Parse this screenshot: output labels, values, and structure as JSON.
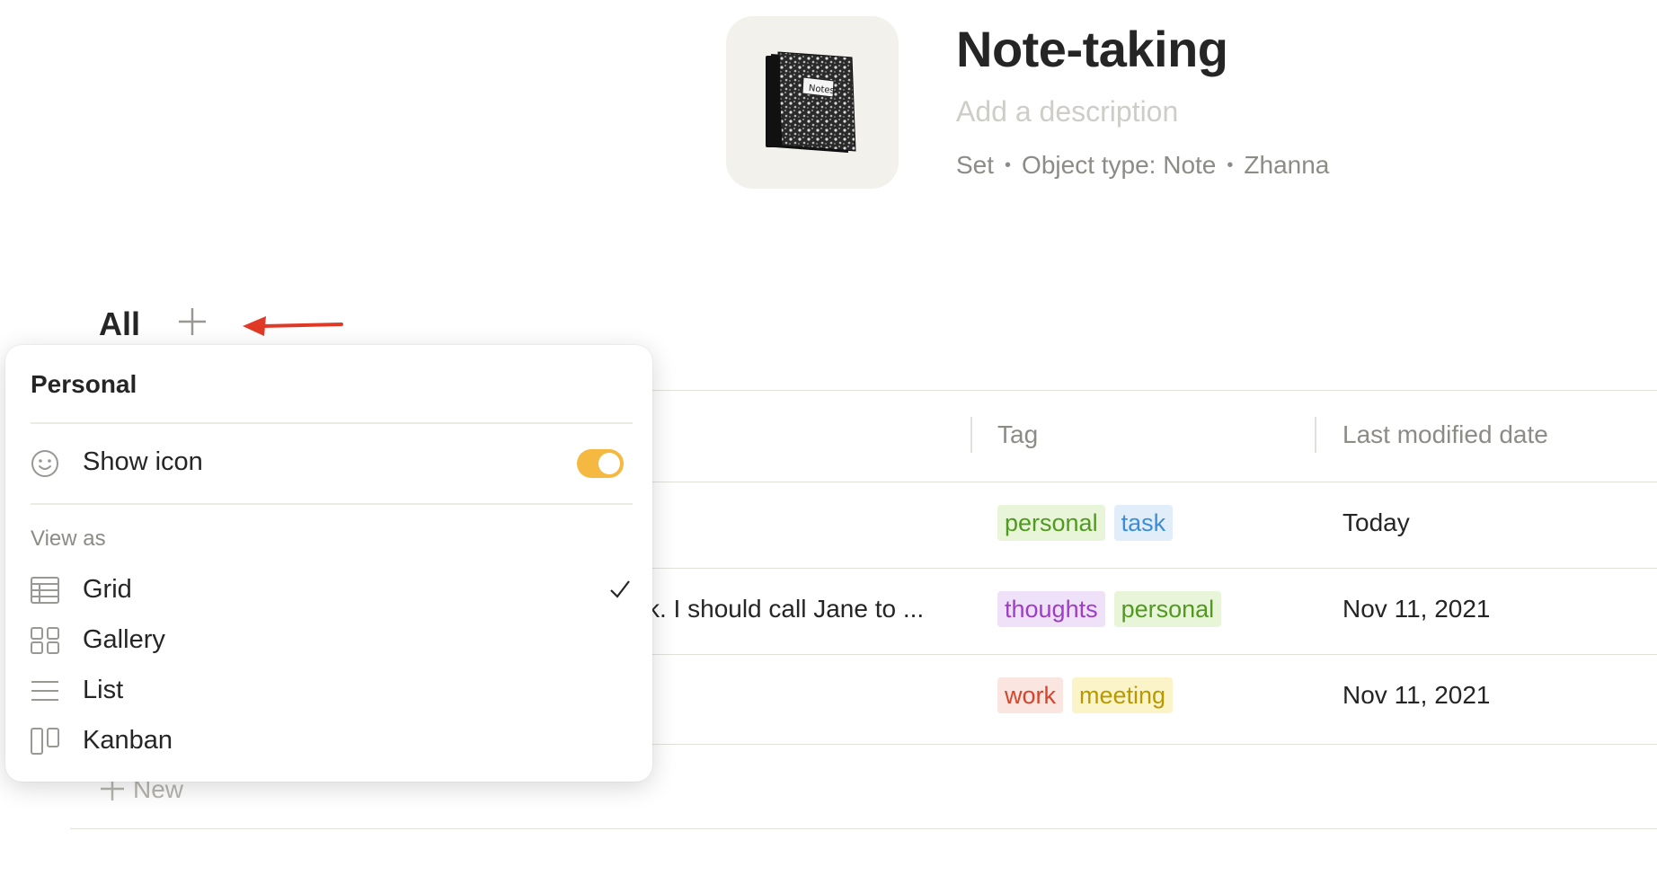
{
  "header": {
    "title": "Note-taking",
    "description_placeholder": "Add a description",
    "meta": [
      "Set",
      "Object type: Note",
      "Zhanna"
    ],
    "icon": "notebook-icon"
  },
  "views": {
    "tabs": [
      "All"
    ],
    "add_icon": "plus-icon"
  },
  "table": {
    "columns": [
      "Tag",
      "Last modified date"
    ],
    "rows": [
      {
        "name": "",
        "tags": [
          {
            "label": "personal",
            "color": "#4f9a1f",
            "bg": "#e8f5d9"
          },
          {
            "label": "task",
            "color": "#3b8ed6",
            "bg": "#e1eef9"
          }
        ],
        "date": "Today"
      },
      {
        "name": "k. I should call Jane to ...",
        "tags": [
          {
            "label": "thoughts",
            "color": "#9d3dc8",
            "bg": "#efe1f7"
          },
          {
            "label": "personal",
            "color": "#4f9a1f",
            "bg": "#e8f5d9"
          }
        ],
        "date": "Nov 11, 2021"
      },
      {
        "name": "",
        "tags": [
          {
            "label": "work",
            "color": "#d6452b",
            "bg": "#fbe5e0"
          },
          {
            "label": "meeting",
            "color": "#b89a00",
            "bg": "#fbf4c9"
          }
        ],
        "date": "Nov 11, 2021"
      }
    ],
    "new_label": "New"
  },
  "popup": {
    "title": "Personal",
    "show_icon_label": "Show icon",
    "show_icon_enabled": true,
    "view_as_label": "View as",
    "view_options": [
      {
        "label": "Grid",
        "icon": "grid-icon",
        "selected": true
      },
      {
        "label": "Gallery",
        "icon": "gallery-icon",
        "selected": false
      },
      {
        "label": "List",
        "icon": "list-icon",
        "selected": false
      },
      {
        "label": "Kanban",
        "icon": "kanban-icon",
        "selected": false
      }
    ]
  },
  "colors": {
    "accent_toggle": "#f5b942",
    "annotation_arrow": "#e03a26"
  }
}
